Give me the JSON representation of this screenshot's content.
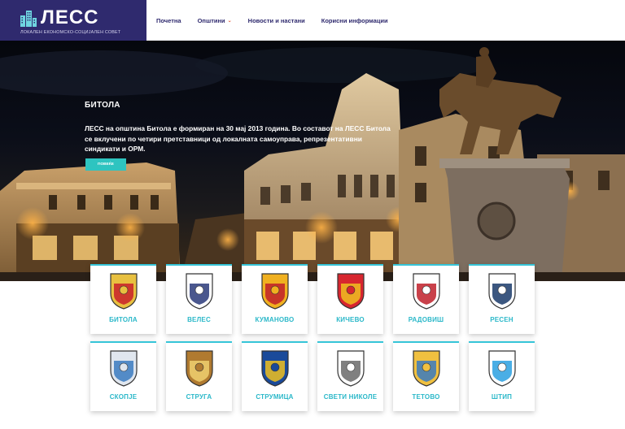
{
  "header": {
    "logo_title": "ЛЕСС",
    "logo_subtitle": "ЛОКАЛЕН ЕКОНОМСКО-СОЦИЈАЛЕН СОВЕТ",
    "brand_color": "#2f2a6e",
    "nav": [
      {
        "label": "Почетна"
      },
      {
        "label": "Општини",
        "dropdown": true
      },
      {
        "label": "Новости и настани"
      },
      {
        "label": "Корисни информации"
      }
    ]
  },
  "hero": {
    "title": "БИТОЛА",
    "text": "ЛЕСС на општина Битола е формиран на 30 мај 2013 година. Во составот на ЛЕСС Битола се вклучени по четири претставници од локалната самоуправа, репрезентативни синдикати и ОРМ.",
    "button_label": "ПОВЕЌЕ",
    "button_color": "#2ec4c0"
  },
  "municipalities": [
    {
      "name": "БИТОЛА",
      "icon": "bitola-coat-of-arms-icon"
    },
    {
      "name": "ВЕЛЕС",
      "icon": "veles-coat-of-arms-icon"
    },
    {
      "name": "КУМАНОВО",
      "icon": "kumanovo-coat-of-arms-icon"
    },
    {
      "name": "КИЧЕВО",
      "icon": "kichevo-coat-of-arms-icon"
    },
    {
      "name": "РАДОВИШ",
      "icon": "radovish-coat-of-arms-icon"
    },
    {
      "name": "РЕСЕН",
      "icon": "resen-coat-of-arms-icon"
    },
    {
      "name": "СКОПЈЕ",
      "icon": "skopje-coat-of-arms-icon"
    },
    {
      "name": "СТРУГА",
      "icon": "struga-coat-of-arms-icon"
    },
    {
      "name": "СТРУМИЦА",
      "icon": "strumica-coat-of-arms-icon"
    },
    {
      "name": "СВЕТИ НИКОЛЕ",
      "icon": "sveti-nikole-coat-of-arms-icon"
    },
    {
      "name": "ТЕТОВО",
      "icon": "tetovo-coat-of-arms-icon"
    },
    {
      "name": "ШТИП",
      "icon": "shtip-coat-of-arms-icon"
    }
  ],
  "card_accent_color": "#36c5d8"
}
